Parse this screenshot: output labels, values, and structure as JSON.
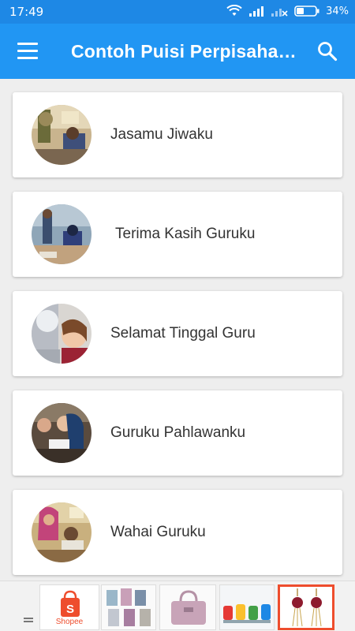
{
  "status_bar": {
    "time": "17:49",
    "battery": "34%"
  },
  "app_bar": {
    "title": "Contoh Puisi Perpisahan Guru"
  },
  "poems": [
    {
      "title": "Jasamu Jiwaku"
    },
    {
      "title": "Terima Kasih Guruku"
    },
    {
      "title": "Selamat Tinggal Guru"
    },
    {
      "title": "Guruku Pahlawanku"
    },
    {
      "title": "Wahai Guruku"
    }
  ],
  "ad_bar": {
    "brand_label": "Shopee"
  },
  "colors": {
    "status_bar": "#1e88e5",
    "app_bar": "#2196f3",
    "accent": "#ee4d2d"
  }
}
